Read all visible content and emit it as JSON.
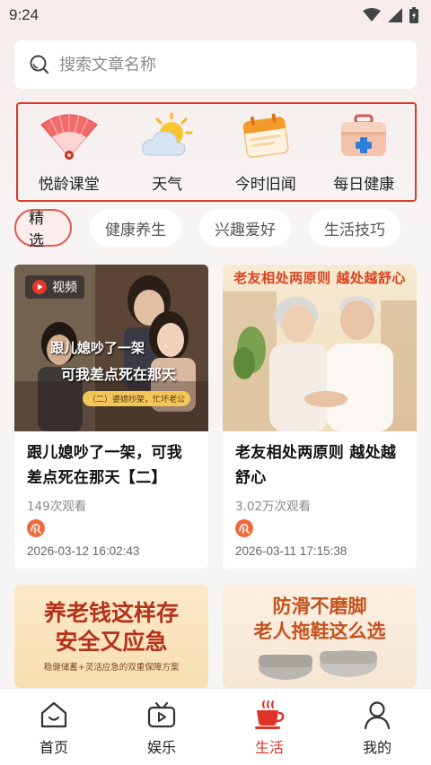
{
  "status_bar": {
    "time": "9:24"
  },
  "search": {
    "placeholder": "搜索文章名称"
  },
  "quick_links": [
    {
      "label": "悦龄课堂",
      "icon": "folding-fan-icon"
    },
    {
      "label": "天气",
      "icon": "weather-icon"
    },
    {
      "label": "今时旧闻",
      "icon": "calendar-icon"
    },
    {
      "label": "每日健康",
      "icon": "medical-kit-icon"
    }
  ],
  "tabs": [
    {
      "label": "精选",
      "active": true
    },
    {
      "label": "健康养生",
      "active": false
    },
    {
      "label": "兴趣爱好",
      "active": false
    },
    {
      "label": "生活技巧",
      "active": false
    }
  ],
  "cards": [
    {
      "badge": "视频",
      "thumb_title_1": "跟儿媳吵了一架",
      "thumb_title_2": "可我差点死在那天",
      "thumb_sub": "（二）婆媳吵架，忙坏老公",
      "title": "跟儿媳吵了一架，可我差点死在那天【二】",
      "views": "149次观看",
      "date": "2026-03-12 16:02:43"
    },
    {
      "thumb_banner": "老友相处两原则 越处越舒心",
      "title": "老友相处两原则 越处越舒心",
      "views": "3.02万次观看",
      "date": "2026-03-11 17:15:38"
    },
    {
      "thumb_title_1": "养老钱这样存",
      "thumb_title_2": "安全又应急",
      "thumb_sub": "稳健储蓄+灵活应急的双重保障方案"
    },
    {
      "thumb_title_1": "防滑不磨脚",
      "thumb_title_2": "老人拖鞋这么选"
    }
  ],
  "bottom_nav": [
    {
      "label": "首页",
      "icon": "home-icon",
      "active": false
    },
    {
      "label": "娱乐",
      "icon": "tv-icon",
      "active": false
    },
    {
      "label": "生活",
      "icon": "coffee-cup-icon",
      "active": true
    },
    {
      "label": "我的",
      "icon": "person-icon",
      "active": false
    }
  ],
  "colors": {
    "accent": "#e03226",
    "highlight_border": "#d93a2b"
  }
}
